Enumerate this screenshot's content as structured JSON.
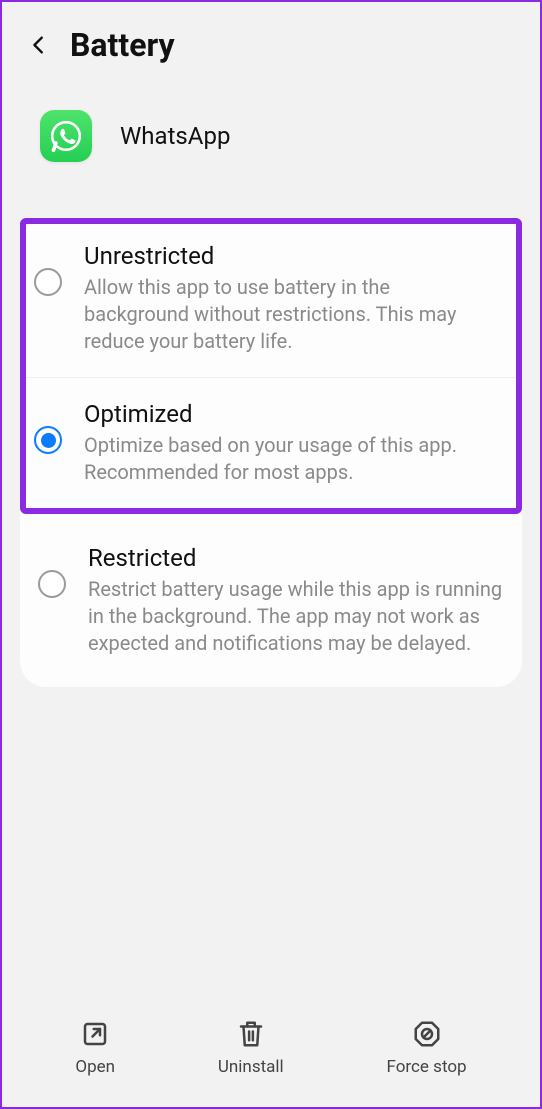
{
  "header": {
    "title": "Battery"
  },
  "app": {
    "name": "WhatsApp"
  },
  "options": [
    {
      "title": "Unrestricted",
      "desc": "Allow this app to use battery in the background without restrictions. This may reduce your battery life.",
      "selected": false
    },
    {
      "title": "Optimized",
      "desc": "Optimize based on your usage of this app. Recommended for most apps.",
      "selected": true
    },
    {
      "title": "Restricted",
      "desc": "Restrict battery usage while this app is running in the background. The app may not work as expected and notifications may be delayed.",
      "selected": false
    }
  ],
  "bottom": {
    "open": "Open",
    "uninstall": "Uninstall",
    "force_stop": "Force stop"
  }
}
